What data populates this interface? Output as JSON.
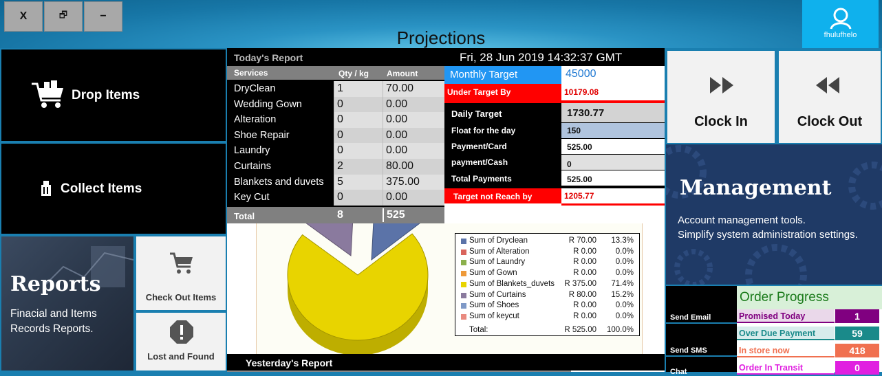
{
  "window_controls": {
    "close": "X",
    "restore": "🗗",
    "minimize": "−"
  },
  "title": "Projections",
  "user": {
    "name": "fhulufhelo"
  },
  "left": {
    "drop_items": "Drop Items",
    "collect_items": "Collect Items",
    "reports": {
      "title": "Reports",
      "desc1": "Finacial and Items",
      "desc2": "Records Reports."
    },
    "check_out": "Check Out Items",
    "lost_found": "Lost and Found"
  },
  "report": {
    "header": "Today's Report",
    "datetime": "Fri, 28 Jun 2019 14:32:37 GMT",
    "columns": {
      "service": "Services",
      "qty": "Qty / kg",
      "amount": "Amount"
    },
    "rows": [
      {
        "name": "DryClean",
        "qty": "1",
        "amount": "70.00"
      },
      {
        "name": "Wedding Gown",
        "qty": "0",
        "amount": "0.00"
      },
      {
        "name": "Alteration",
        "qty": "0",
        "amount": "0.00"
      },
      {
        "name": "Shoe Repair",
        "qty": "0",
        "amount": "0.00"
      },
      {
        "name": "Laundry",
        "qty": "0",
        "amount": "0.00"
      },
      {
        "name": "Curtains",
        "qty": "2",
        "amount": "80.00"
      },
      {
        "name": "Blankets and duvets",
        "qty": "5",
        "amount": "375.00"
      },
      {
        "name": "Key Cut",
        "qty": "0",
        "amount": "0.00"
      }
    ],
    "total": {
      "label": "Total",
      "qty": "8",
      "amount": "525"
    },
    "yesterday": "Yesterday's Report"
  },
  "targets": {
    "monthly_label": "Monthly Target",
    "monthly_value": "45000",
    "under_label": "Under Target By",
    "under_value": "10179.08",
    "daily_label": "Daily Target",
    "daily_value": "1730.77",
    "float_label": "Float for the day",
    "float_value": "150",
    "card_label": "Payment/Card",
    "card_value": "525.00",
    "cash_label": "payment/Cash",
    "cash_value": "0",
    "total_label": "Total Payments",
    "total_value": "525.00",
    "notreach_label": "Target not Reach by",
    "notreach_value": "1205.77"
  },
  "chart_data": {
    "type": "pie",
    "categories": [
      "Sum of Dryclean",
      "Sum of Alteration",
      "Sum of Laundry",
      "Sum of Gown",
      "Sum of Blankets_duvets",
      "Sum of Curtains",
      "Sum of Shoes",
      "Sum of keycut"
    ],
    "values": [
      70.0,
      0.0,
      0.0,
      0.0,
      375.0,
      80.0,
      0.0,
      0.0
    ],
    "value_labels": [
      "R 70.00",
      "R 0.00",
      "R 0.00",
      "R 0.00",
      "R 375.00",
      "R 80.00",
      "R 0.00",
      "R 0.00"
    ],
    "percents": [
      "13.3%",
      "0.0%",
      "0.0%",
      "0.0%",
      "71.4%",
      "15.2%",
      "0.0%",
      "0.0%"
    ],
    "colors": [
      "#5b73a8",
      "#d9645c",
      "#8bb04c",
      "#ee9a3a",
      "#e8d400",
      "#8a7a9e",
      "#7f99c7",
      "#e98a80"
    ],
    "total_label": "Total:",
    "total_value": "R 525.00",
    "total_percent": "100.0%",
    "legend_position": "right"
  },
  "right": {
    "clock_in": "Clock In",
    "clock_out": "Clock Out",
    "management": {
      "title": "Management",
      "desc1": "Account management tools.",
      "desc2": "Simplify system administration settings."
    },
    "send_email": "Send Email",
    "send_sms": "Send SMS",
    "chat": "Chat",
    "order_progress": {
      "title": "Order Progress",
      "items": [
        {
          "label": "Promised Today",
          "value": "1",
          "color": "#800080",
          "label_color": "#800080"
        },
        {
          "label": "Over Due Payment",
          "value": "59",
          "color": "#1a8a8a",
          "label_color": "#1a8a8a"
        },
        {
          "label": "In store now",
          "value": "418",
          "color": "#f07050",
          "label_color": "#f07050"
        },
        {
          "label": "Order In Transit",
          "value": "0",
          "color": "#e020e0",
          "label_color": "#e020e0"
        }
      ]
    }
  }
}
